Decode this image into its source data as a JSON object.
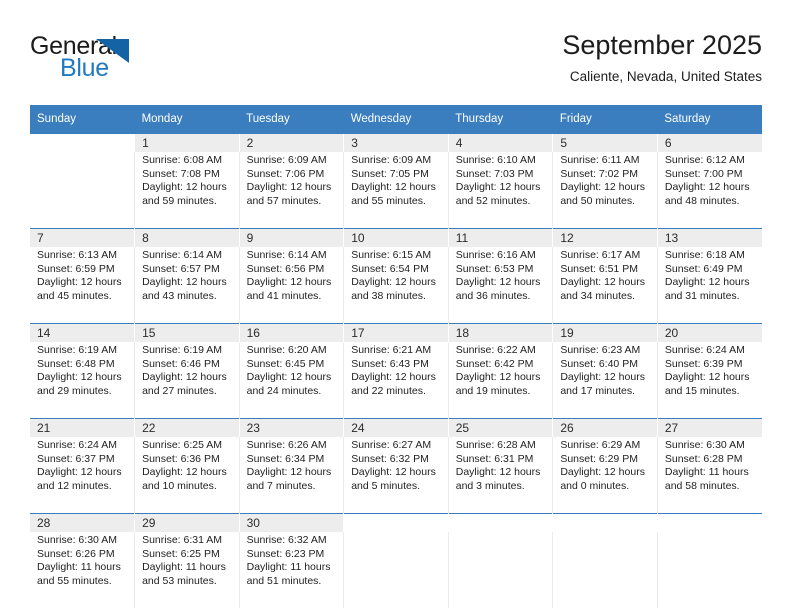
{
  "logo": {
    "word_one": "General",
    "word_two": "Blue",
    "accent_color": "#1464a5",
    "blue_text_color": "#1f7ac0"
  },
  "header": {
    "title": "September 2025",
    "subtitle": "Caliente, Nevada, United States"
  },
  "theme": {
    "header_bar_color": "#3a7ebf",
    "daynum_band_color": "#ededed",
    "text_color": "#1f1f1f"
  },
  "calendar": {
    "weekday_headers": [
      "Sunday",
      "Monday",
      "Tuesday",
      "Wednesday",
      "Thursday",
      "Friday",
      "Saturday"
    ],
    "weeks": [
      {
        "days": [
          {
            "day": "",
            "sunrise": "",
            "sunset": "",
            "daylight_1": "",
            "daylight_2": ""
          },
          {
            "day": "1",
            "sunrise": "Sunrise: 6:08 AM",
            "sunset": "Sunset: 7:08 PM",
            "daylight_1": "Daylight: 12 hours",
            "daylight_2": "and 59 minutes."
          },
          {
            "day": "2",
            "sunrise": "Sunrise: 6:09 AM",
            "sunset": "Sunset: 7:06 PM",
            "daylight_1": "Daylight: 12 hours",
            "daylight_2": "and 57 minutes."
          },
          {
            "day": "3",
            "sunrise": "Sunrise: 6:09 AM",
            "sunset": "Sunset: 7:05 PM",
            "daylight_1": "Daylight: 12 hours",
            "daylight_2": "and 55 minutes."
          },
          {
            "day": "4",
            "sunrise": "Sunrise: 6:10 AM",
            "sunset": "Sunset: 7:03 PM",
            "daylight_1": "Daylight: 12 hours",
            "daylight_2": "and 52 minutes."
          },
          {
            "day": "5",
            "sunrise": "Sunrise: 6:11 AM",
            "sunset": "Sunset: 7:02 PM",
            "daylight_1": "Daylight: 12 hours",
            "daylight_2": "and 50 minutes."
          },
          {
            "day": "6",
            "sunrise": "Sunrise: 6:12 AM",
            "sunset": "Sunset: 7:00 PM",
            "daylight_1": "Daylight: 12 hours",
            "daylight_2": "and 48 minutes."
          }
        ]
      },
      {
        "days": [
          {
            "day": "7",
            "sunrise": "Sunrise: 6:13 AM",
            "sunset": "Sunset: 6:59 PM",
            "daylight_1": "Daylight: 12 hours",
            "daylight_2": "and 45 minutes."
          },
          {
            "day": "8",
            "sunrise": "Sunrise: 6:14 AM",
            "sunset": "Sunset: 6:57 PM",
            "daylight_1": "Daylight: 12 hours",
            "daylight_2": "and 43 minutes."
          },
          {
            "day": "9",
            "sunrise": "Sunrise: 6:14 AM",
            "sunset": "Sunset: 6:56 PM",
            "daylight_1": "Daylight: 12 hours",
            "daylight_2": "and 41 minutes."
          },
          {
            "day": "10",
            "sunrise": "Sunrise: 6:15 AM",
            "sunset": "Sunset: 6:54 PM",
            "daylight_1": "Daylight: 12 hours",
            "daylight_2": "and 38 minutes."
          },
          {
            "day": "11",
            "sunrise": "Sunrise: 6:16 AM",
            "sunset": "Sunset: 6:53 PM",
            "daylight_1": "Daylight: 12 hours",
            "daylight_2": "and 36 minutes."
          },
          {
            "day": "12",
            "sunrise": "Sunrise: 6:17 AM",
            "sunset": "Sunset: 6:51 PM",
            "daylight_1": "Daylight: 12 hours",
            "daylight_2": "and 34 minutes."
          },
          {
            "day": "13",
            "sunrise": "Sunrise: 6:18 AM",
            "sunset": "Sunset: 6:49 PM",
            "daylight_1": "Daylight: 12 hours",
            "daylight_2": "and 31 minutes."
          }
        ]
      },
      {
        "days": [
          {
            "day": "14",
            "sunrise": "Sunrise: 6:19 AM",
            "sunset": "Sunset: 6:48 PM",
            "daylight_1": "Daylight: 12 hours",
            "daylight_2": "and 29 minutes."
          },
          {
            "day": "15",
            "sunrise": "Sunrise: 6:19 AM",
            "sunset": "Sunset: 6:46 PM",
            "daylight_1": "Daylight: 12 hours",
            "daylight_2": "and 27 minutes."
          },
          {
            "day": "16",
            "sunrise": "Sunrise: 6:20 AM",
            "sunset": "Sunset: 6:45 PM",
            "daylight_1": "Daylight: 12 hours",
            "daylight_2": "and 24 minutes."
          },
          {
            "day": "17",
            "sunrise": "Sunrise: 6:21 AM",
            "sunset": "Sunset: 6:43 PM",
            "daylight_1": "Daylight: 12 hours",
            "daylight_2": "and 22 minutes."
          },
          {
            "day": "18",
            "sunrise": "Sunrise: 6:22 AM",
            "sunset": "Sunset: 6:42 PM",
            "daylight_1": "Daylight: 12 hours",
            "daylight_2": "and 19 minutes."
          },
          {
            "day": "19",
            "sunrise": "Sunrise: 6:23 AM",
            "sunset": "Sunset: 6:40 PM",
            "daylight_1": "Daylight: 12 hours",
            "daylight_2": "and 17 minutes."
          },
          {
            "day": "20",
            "sunrise": "Sunrise: 6:24 AM",
            "sunset": "Sunset: 6:39 PM",
            "daylight_1": "Daylight: 12 hours",
            "daylight_2": "and 15 minutes."
          }
        ]
      },
      {
        "days": [
          {
            "day": "21",
            "sunrise": "Sunrise: 6:24 AM",
            "sunset": "Sunset: 6:37 PM",
            "daylight_1": "Daylight: 12 hours",
            "daylight_2": "and 12 minutes."
          },
          {
            "day": "22",
            "sunrise": "Sunrise: 6:25 AM",
            "sunset": "Sunset: 6:36 PM",
            "daylight_1": "Daylight: 12 hours",
            "daylight_2": "and 10 minutes."
          },
          {
            "day": "23",
            "sunrise": "Sunrise: 6:26 AM",
            "sunset": "Sunset: 6:34 PM",
            "daylight_1": "Daylight: 12 hours",
            "daylight_2": "and 7 minutes."
          },
          {
            "day": "24",
            "sunrise": "Sunrise: 6:27 AM",
            "sunset": "Sunset: 6:32 PM",
            "daylight_1": "Daylight: 12 hours",
            "daylight_2": "and 5 minutes."
          },
          {
            "day": "25",
            "sunrise": "Sunrise: 6:28 AM",
            "sunset": "Sunset: 6:31 PM",
            "daylight_1": "Daylight: 12 hours",
            "daylight_2": "and 3 minutes."
          },
          {
            "day": "26",
            "sunrise": "Sunrise: 6:29 AM",
            "sunset": "Sunset: 6:29 PM",
            "daylight_1": "Daylight: 12 hours",
            "daylight_2": "and 0 minutes."
          },
          {
            "day": "27",
            "sunrise": "Sunrise: 6:30 AM",
            "sunset": "Sunset: 6:28 PM",
            "daylight_1": "Daylight: 11 hours",
            "daylight_2": "and 58 minutes."
          }
        ]
      },
      {
        "days": [
          {
            "day": "28",
            "sunrise": "Sunrise: 6:30 AM",
            "sunset": "Sunset: 6:26 PM",
            "daylight_1": "Daylight: 11 hours",
            "daylight_2": "and 55 minutes."
          },
          {
            "day": "29",
            "sunrise": "Sunrise: 6:31 AM",
            "sunset": "Sunset: 6:25 PM",
            "daylight_1": "Daylight: 11 hours",
            "daylight_2": "and 53 minutes."
          },
          {
            "day": "30",
            "sunrise": "Sunrise: 6:32 AM",
            "sunset": "Sunset: 6:23 PM",
            "daylight_1": "Daylight: 11 hours",
            "daylight_2": "and 51 minutes."
          },
          {
            "day": "",
            "sunrise": "",
            "sunset": "",
            "daylight_1": "",
            "daylight_2": ""
          },
          {
            "day": "",
            "sunrise": "",
            "sunset": "",
            "daylight_1": "",
            "daylight_2": ""
          },
          {
            "day": "",
            "sunrise": "",
            "sunset": "",
            "daylight_1": "",
            "daylight_2": ""
          },
          {
            "day": "",
            "sunrise": "",
            "sunset": "",
            "daylight_1": "",
            "daylight_2": ""
          }
        ]
      }
    ]
  }
}
